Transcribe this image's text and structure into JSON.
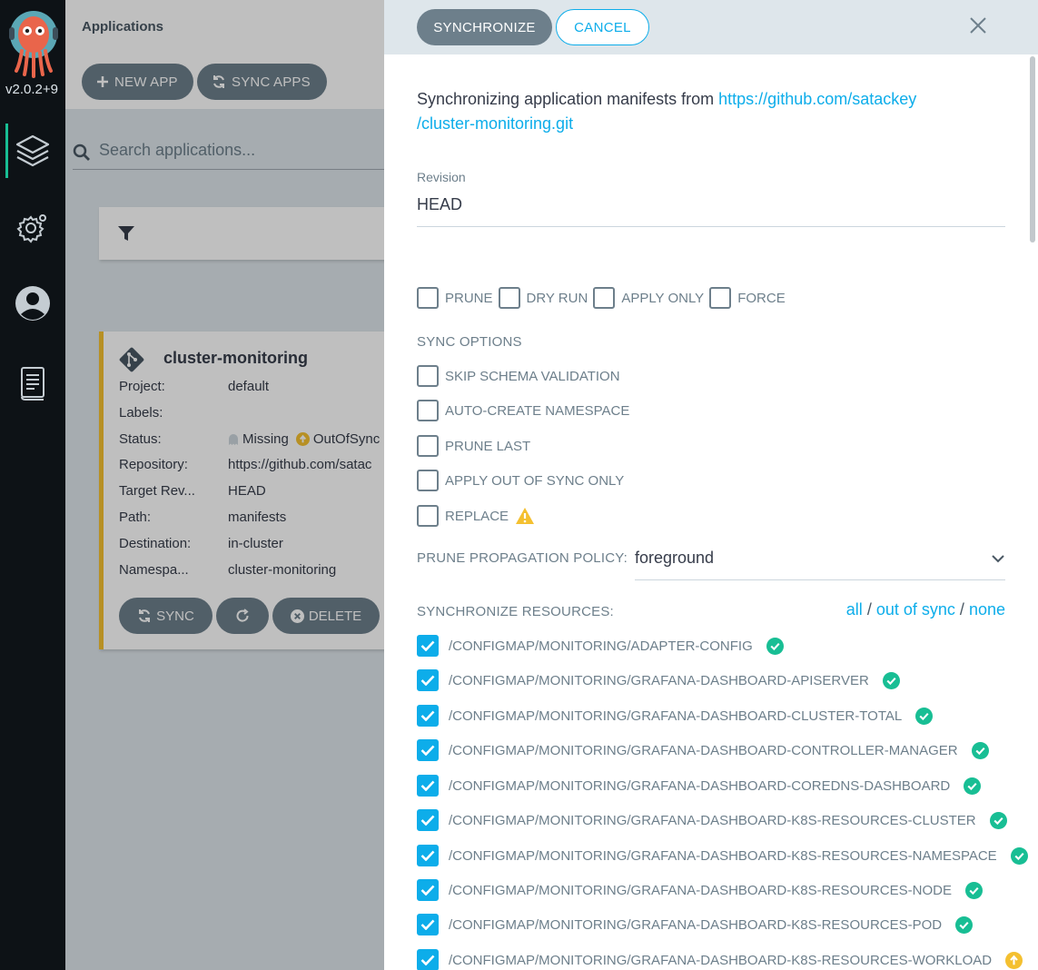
{
  "nav": {
    "version": "v2.0.2+9",
    "items": [
      "applications",
      "settings",
      "user-info",
      "documentation"
    ]
  },
  "header": {
    "title": "Applications",
    "new_app_label": "NEW APP",
    "sync_apps_label": "SYNC APPS"
  },
  "search": {
    "placeholder": "Search applications..."
  },
  "app_card": {
    "name": "cluster-monitoring",
    "rows": [
      {
        "key": "Project:",
        "value": "default"
      },
      {
        "key": "Labels:",
        "value": ""
      },
      {
        "key": "Status:",
        "value": ""
      },
      {
        "key": "Repository:",
        "value": "https://github.com/satac"
      },
      {
        "key": "Target Rev...",
        "value": "HEAD"
      },
      {
        "key": "Path:",
        "value": "manifests"
      },
      {
        "key": "Destination:",
        "value": "in-cluster"
      },
      {
        "key": "Namespa...",
        "value": "cluster-monitoring"
      }
    ],
    "status_health": "Missing",
    "status_sync": "OutOfSync",
    "sync_label": "SYNC",
    "delete_label": "DELETE"
  },
  "panel": {
    "synchronize_label": "SYNCHRONIZE",
    "cancel_label": "CANCEL",
    "intro_text": "Synchronizing application manifests from ",
    "repo_link_line1": "https://github.com/satackey",
    "repo_link_line2": "/cluster-monitoring.git",
    "revision_label": "Revision",
    "revision_value": "HEAD",
    "options": [
      "PRUNE",
      "DRY RUN",
      "APPLY ONLY",
      "FORCE"
    ],
    "sync_options_label": "SYNC OPTIONS",
    "sync_options": [
      "SKIP SCHEMA VALIDATION",
      "AUTO-CREATE NAMESPACE",
      "PRUNE LAST",
      "APPLY OUT OF SYNC ONLY",
      "REPLACE"
    ],
    "prune_policy_label": "PRUNE PROPAGATION POLICY:",
    "prune_policy_value": "foreground",
    "sync_resources_label": "SYNCHRONIZE RESOURCES:",
    "select_all": "all",
    "select_out_of_sync": "out of sync",
    "select_none": "none",
    "separator": "/",
    "resources": [
      {
        "name": "/CONFIGMAP/MONITORING/ADAPTER-CONFIG",
        "status": "synced"
      },
      {
        "name": "/CONFIGMAP/MONITORING/GRAFANA-DASHBOARD-APISERVER",
        "status": "synced"
      },
      {
        "name": "/CONFIGMAP/MONITORING/GRAFANA-DASHBOARD-CLUSTER-TOTAL",
        "status": "synced"
      },
      {
        "name": "/CONFIGMAP/MONITORING/GRAFANA-DASHBOARD-CONTROLLER-MANAGER",
        "status": "synced"
      },
      {
        "name": "/CONFIGMAP/MONITORING/GRAFANA-DASHBOARD-COREDNS-DASHBOARD",
        "status": "synced"
      },
      {
        "name": "/CONFIGMAP/MONITORING/GRAFANA-DASHBOARD-K8S-RESOURCES-CLUSTER",
        "status": "synced"
      },
      {
        "name": "/CONFIGMAP/MONITORING/GRAFANA-DASHBOARD-K8S-RESOURCES-NAMESPACE",
        "status": "synced"
      },
      {
        "name": "/CONFIGMAP/MONITORING/GRAFANA-DASHBOARD-K8S-RESOURCES-NODE",
        "status": "synced"
      },
      {
        "name": "/CONFIGMAP/MONITORING/GRAFANA-DASHBOARD-K8S-RESOURCES-POD",
        "status": "synced"
      },
      {
        "name": "/CONFIGMAP/MONITORING/GRAFANA-DASHBOARD-K8S-RESOURCES-WORKLOAD",
        "status": "out-of-sync"
      }
    ]
  },
  "colors": {
    "accent": "#0dadea",
    "synced": "#18be94",
    "out_of_sync": "#f4c030",
    "button": "#6d7f8b",
    "nav_bg": "#0d1216"
  }
}
